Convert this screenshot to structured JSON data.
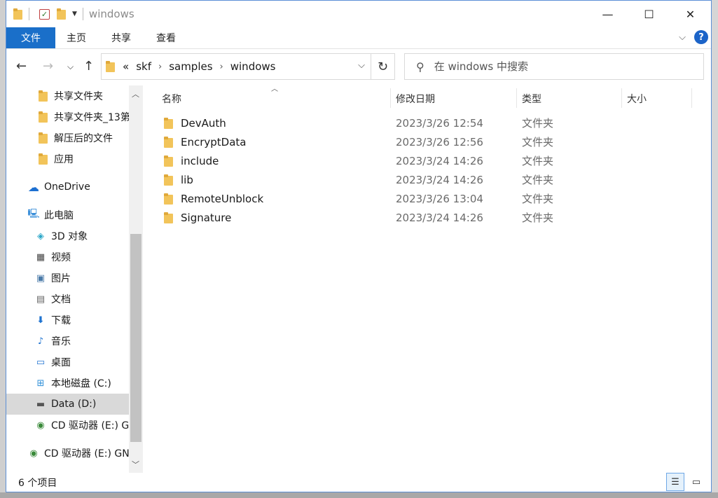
{
  "window": {
    "title": "windows"
  },
  "quick_access": {
    "icons": [
      "folder-icon",
      "properties-checkbox-icon",
      "new-folder-icon",
      "customize-dropdown-icon"
    ]
  },
  "window_buttons": {
    "minimize": "—",
    "maximize": "☐",
    "close": "✕"
  },
  "ribbon": {
    "tabs": [
      "文件",
      "主页",
      "共享",
      "查看"
    ],
    "help": "?"
  },
  "address": {
    "overflow": "«",
    "crumbs": [
      "skf",
      "samples",
      "windows"
    ]
  },
  "search": {
    "placeholder": "在 windows 中搜索"
  },
  "nav": {
    "items": [
      {
        "label": "共享文件夹",
        "icon": "shared-folder-icon"
      },
      {
        "label": "共享文件夹_13第",
        "icon": "shared-folder-icon"
      },
      {
        "label": "解压后的文件",
        "icon": "folder-icon"
      },
      {
        "label": "应用",
        "icon": "shared-folder-icon"
      },
      {
        "label": "OneDrive",
        "icon": "onedrive-cloud-icon"
      },
      {
        "label": "此电脑",
        "icon": "this-pc-icon"
      },
      {
        "label": "3D 对象",
        "icon": "3d-objects-icon"
      },
      {
        "label": "视频",
        "icon": "video-icon"
      },
      {
        "label": "图片",
        "icon": "pictures-icon"
      },
      {
        "label": "文档",
        "icon": "documents-icon"
      },
      {
        "label": "下载",
        "icon": "download-icon"
      },
      {
        "label": "音乐",
        "icon": "music-icon"
      },
      {
        "label": "桌面",
        "icon": "desktop-icon"
      },
      {
        "label": "本地磁盘 (C:)",
        "icon": "local-disk-icon"
      },
      {
        "label": "Data (D:)",
        "icon": "drive-icon"
      },
      {
        "label": "CD 驱动器 (E:) G",
        "icon": "cd-drive-icon"
      },
      {
        "label": "CD 驱动器 (E:) GN",
        "icon": "cd-drive-icon"
      }
    ]
  },
  "columns": {
    "name": "名称",
    "date": "修改日期",
    "type": "类型",
    "size": "大小"
  },
  "files": [
    {
      "name": "DevAuth",
      "date": "2023/3/26 12:54",
      "type": "文件夹"
    },
    {
      "name": "EncryptData",
      "date": "2023/3/26 12:56",
      "type": "文件夹"
    },
    {
      "name": "include",
      "date": "2023/3/24 14:26",
      "type": "文件夹"
    },
    {
      "name": "lib",
      "date": "2023/3/24 14:26",
      "type": "文件夹"
    },
    {
      "name": "RemoteUnblock",
      "date": "2023/3/26 13:04",
      "type": "文件夹"
    },
    {
      "name": "Signature",
      "date": "2023/3/24 14:26",
      "type": "文件夹"
    }
  ],
  "status": {
    "count": "6 个项目"
  },
  "colors": {
    "accent": "#1a6fc9",
    "selected_nav": "#d9d9d9",
    "folder": "#f2c45a"
  }
}
